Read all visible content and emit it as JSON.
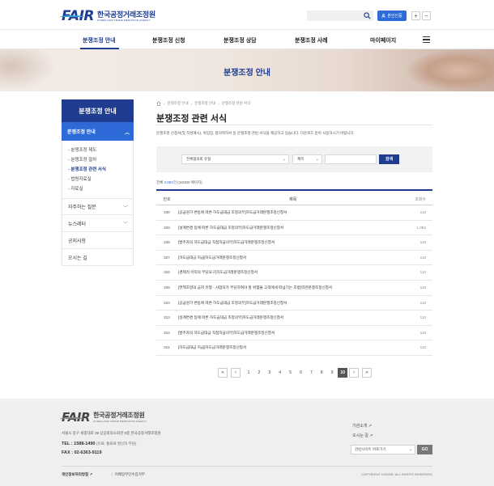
{
  "header": {
    "logo_mark": "FAIR",
    "logo_ko": "한국공정거래조정원",
    "logo_en": "KOREA FAIR TRADE MEDIATION AGENCY",
    "login_label": "본인인증",
    "zoom_in": "+",
    "zoom_out": "−"
  },
  "gnb": [
    "분쟁조정 안내",
    "분쟁조정 신청",
    "분쟁조정 상담",
    "분쟁조정 사례",
    "마이페이지"
  ],
  "banner_title": "분쟁조정 안내",
  "sidebar": {
    "title": "분쟁조정 안내",
    "active_group": "분쟁조정 안내",
    "sub_items": [
      "- 분쟁조정 제도",
      "- 분쟁조정 절차",
      "- 분쟁조정 관련 서식",
      "- 법령자료실",
      "- 자료실"
    ],
    "menus": [
      "자주하는 질문",
      "뉴스레터",
      "공지사항",
      "오시는 길"
    ]
  },
  "breadcrumb": [
    "분쟁조정 안내",
    "분쟁조정 안내",
    "분쟁조정 관련 서식"
  ],
  "page_title": "분쟁조정 관련 서식",
  "page_desc": "분쟁조정 신청서(및 작성예시), 위임장, 합의취하서 등 분쟁조정 관련 서식을 제공하고 있습니다. 다운로드 받아 사용하시기 바랍니다.",
  "filter": {
    "category": "전체협의회 유형",
    "field": "제목",
    "search_label": "검색"
  },
  "count": {
    "prefix": "전체",
    "total": "3,583",
    "unit": "건",
    "page_info": "(10/400 페이지)"
  },
  "table": {
    "headers": {
      "no": "번호",
      "title": "제목",
      "views": "조회수"
    },
    "rows": [
      {
        "no": "330",
        "title": "[공급원가 변동에 따른 하도급대금 조정의무]하도급거래분쟁조정신청서",
        "views": "110"
      },
      {
        "no": "329",
        "title": "[설계변경 등에 따른 하도급대금 조정의무]하도급거래분쟁조정신청서",
        "views": "1,052"
      },
      {
        "no": "328",
        "title": "[발주자의 하도급대금 직접지급의무]하도급거래분쟁조정신청서",
        "views": "110"
      },
      {
        "no": "327",
        "title": "[하도급대금 지급]하도급거래분쟁조정신청서",
        "views": "110"
      },
      {
        "no": "326",
        "title": "[경제적 이익의 부당요구]하도급거래분쟁조정신청서",
        "views": "110"
      },
      {
        "no": "325",
        "title": "[면책조항의 금지 유형 - 사업자가 부담하여야 할 위험을 고객에게 떠넘기는 조항]약관분쟁조정신청서",
        "views": "110"
      },
      {
        "no": "324",
        "title": "[공급원가 변동에 따른 하도급대금 조정의무]하도급거래분쟁조정신청서",
        "views": "110"
      },
      {
        "no": "323",
        "title": "[설계변경 등에 따른 하도급대금 조정의무]하도급거래분쟁조정신청서",
        "views": "110"
      },
      {
        "no": "322",
        "title": "[발주자의 하도급대금 직접지급의무]하도급거래분쟁조정신청서",
        "views": "110"
      },
      {
        "no": "321",
        "title": "[하도급대금 지급]하도급거래분쟁조정신청서",
        "views": "110"
      }
    ]
  },
  "pager": {
    "first": "«",
    "prev": "‹",
    "next": "›",
    "last": "»",
    "pages": [
      "1",
      "2",
      "3",
      "4",
      "5",
      "6",
      "7",
      "8",
      "9",
      "10"
    ],
    "current": "10"
  },
  "footer": {
    "logo_mark": "FAIR",
    "logo_ko": "한국공정거래조정원",
    "logo_en": "KOREA FAIR TRADE MEDIATION AGENCY",
    "address": "서울시 중구 세종대로 39 상공회의소회관 9층 한국공정거래조정원",
    "tel": "TEL : 1588-1490",
    "tel_note": "(유료, 통화료 발신자 부담)",
    "fax": "FAX : 02-6363-9119",
    "links_right": [
      "기관소개",
      "오시는 길"
    ],
    "related_sites": "관련사이트 바로가기",
    "go": "GO",
    "bottom_links": [
      "개인정보처리방침",
      "이메일무단수집거부"
    ],
    "copyright": "COPYRIGHT KOFAIR. ALL RIGHTS RESERVED"
  }
}
